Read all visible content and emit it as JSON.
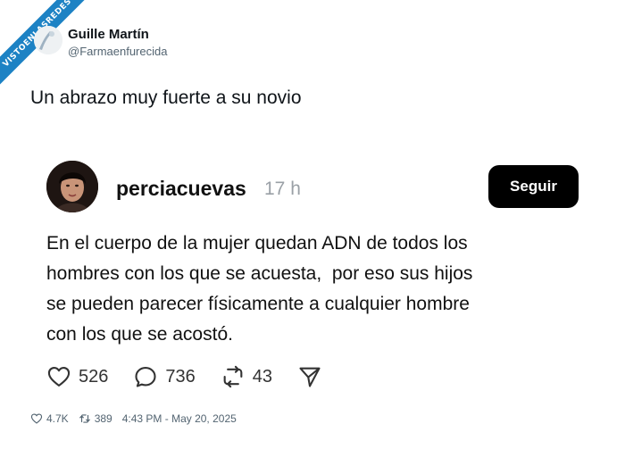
{
  "watermark": {
    "text": "VISTOENLASREDES"
  },
  "author": {
    "name": "Guille Martín",
    "handle": "@Farmaenfurecida"
  },
  "tweet": {
    "text": "Un abrazo muy fuerte a su novio"
  },
  "quoted": {
    "username": "perciacuevas",
    "time": "17 h",
    "follow_label": "Seguir",
    "body_lines": [
      "En el cuerpo de la mujer quedan ADN de todos los",
      "hombres con los que se acuesta,  por eso sus hijos",
      "se pueden parecer físicamente a cualquier hombre",
      "con los que se acostó."
    ],
    "actions": {
      "likes": "526",
      "replies": "736",
      "reposts": "43"
    }
  },
  "footer": {
    "likes": "4.7K",
    "retweets": "389",
    "timestamp": "4:43 PM - May 20, 2025"
  },
  "icons": {
    "heart": "heart-icon",
    "comment": "comment-icon",
    "repost": "repost-icon",
    "share": "share-icon",
    "retweet": "retweet-icon"
  },
  "colors": {
    "ribbon": "#1d82c4",
    "follow_button": "#000000",
    "muted_text": "#536471"
  }
}
